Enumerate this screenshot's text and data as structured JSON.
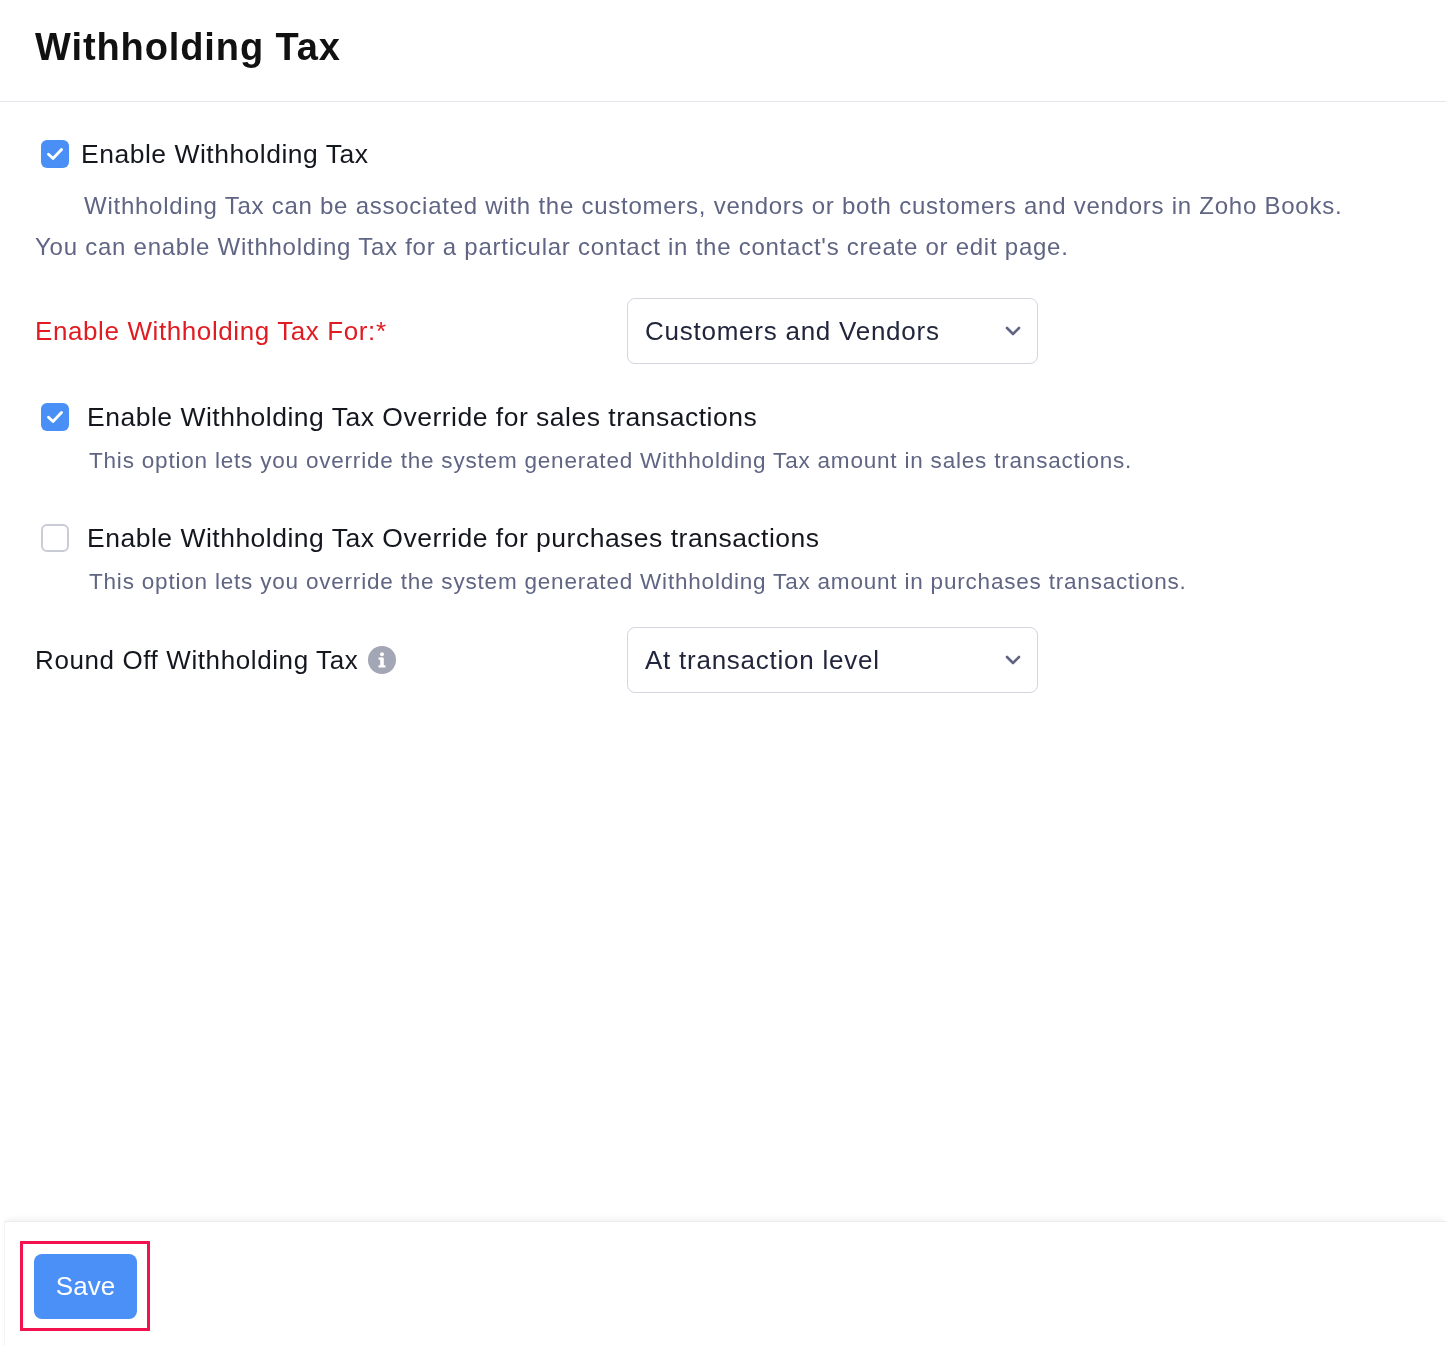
{
  "page": {
    "title": "Withholding Tax"
  },
  "enable_option": {
    "label": "Enable Withholding Tax",
    "checked": true,
    "description": "Withholding Tax can be associated with the customers, vendors or both customers and vendors in Zoho Books. You can enable Withholding Tax for a particular contact in the contact's create or edit page."
  },
  "tax_for": {
    "label": "Enable Withholding Tax For:*",
    "required": true,
    "value": "Customers and Vendors"
  },
  "overrides": [
    {
      "label": "Enable Withholding Tax Override for sales transactions",
      "checked": true,
      "description": "This option lets you override the system generated Withholding Tax amount in sales transactions."
    },
    {
      "label": "Enable Withholding Tax Override for purchases transactions",
      "checked": false,
      "description": "This option lets you override the system generated Withholding Tax amount in purchases transactions."
    }
  ],
  "round_off": {
    "label": "Round Off Withholding Tax",
    "value": "At transaction level"
  },
  "footer": {
    "save_button": {
      "label": "Save",
      "highlighted": true
    }
  }
}
